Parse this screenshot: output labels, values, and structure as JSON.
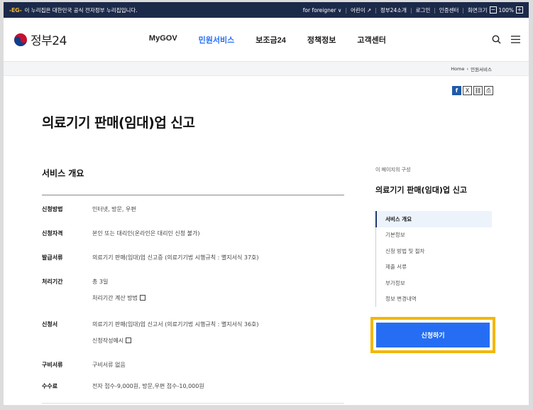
{
  "topbar": {
    "badge": "-EG-",
    "notice": "이 누리집은 대한민국 공식 전자정부 누리집입니다.",
    "links": [
      "for foreigner ∨",
      "어린이 ↗",
      "정부24소개",
      "로그인",
      "인증센터"
    ],
    "zoom_label": "화면크기",
    "zoom_minus": "−",
    "zoom_value": "100%",
    "zoom_plus": "+"
  },
  "header": {
    "logo_text": "정부24",
    "nav": [
      "MyGOV",
      "민원서비스",
      "보조금24",
      "정책정보",
      "고객센터"
    ],
    "active_nav": 1,
    "search_icon": "search-icon",
    "menu_icon": "menu-icon"
  },
  "breadcrumb": {
    "home": "Home",
    "sep": "›",
    "current": "민원서비스"
  },
  "share": {
    "icons": [
      "facebook-icon",
      "x-icon",
      "link-icon",
      "print-icon"
    ],
    "fb": "f",
    "x": "X",
    "link": "⛓",
    "print": "⎙"
  },
  "page": {
    "title": "의료기기 판매(임대)업 신고",
    "section_title": "서비스 개요",
    "rows": [
      {
        "label": "신청방법",
        "values": [
          "인터넷, 방문, 우편"
        ]
      },
      {
        "label": "신청자격",
        "values": [
          "본인 또는 대리인(온라인은 대리인 신청 불가)"
        ]
      },
      {
        "label": "발급서류",
        "values": [
          "의료기기 판매(임대)업 신고증 (의료기기법 시행규칙 : 별지서식 37호)"
        ]
      },
      {
        "label": "처리기간",
        "values": [
          "총 3일",
          "처리기간 계산 방법"
        ]
      },
      {
        "label": "신청서",
        "values": [
          "의료기기 판매(임대)업 신고서 (의료기기법 시행규칙 : 별지서식 36호)",
          "신청작성예시"
        ]
      },
      {
        "label": "구비서류",
        "values": [
          "구비서류 없음"
        ]
      },
      {
        "label": "수수료",
        "values": [
          "전자 접수-9,000원, 방문,우편 접수-10,000원"
        ]
      }
    ]
  },
  "toc": {
    "caption": "이 페이지의 구성",
    "title": "의료기기 판매(임대)업 신고",
    "items": [
      "서비스 개요",
      "기본정보",
      "신청 방법 및 절차",
      "제출 서류",
      "부가정보",
      "정보 변경내역"
    ],
    "active": 0
  },
  "apply": {
    "label": "신청하기"
  },
  "colors": {
    "primary": "#256ef4",
    "topbar": "#1c2a4a",
    "highlight": "#f2b705"
  }
}
